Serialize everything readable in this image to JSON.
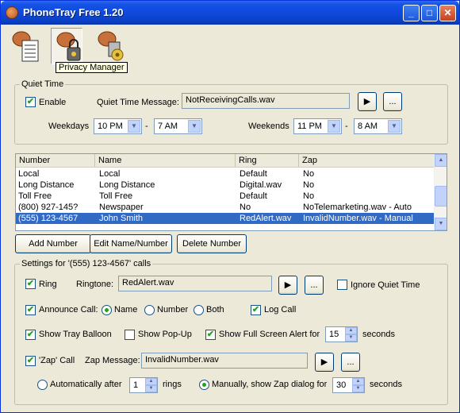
{
  "window": {
    "title": "PhoneTray Free 1.20",
    "minimize": "_",
    "maximize": "□",
    "close": "✕"
  },
  "toolbar": {
    "tooltip": "Privacy Manager"
  },
  "quiet_time": {
    "group_title": "Quiet Time",
    "enable_label": "Enable",
    "enable_checked": "✔",
    "message_label": "Quiet Time Message:",
    "message_value": "NotReceivingCalls.wav",
    "browse": "...",
    "play": "▶",
    "weekdays_label": "Weekdays",
    "weekdays_from": "10 PM",
    "weekdays_to": "7 AM",
    "weekends_label": "Weekends",
    "weekends_from": "11 PM",
    "weekends_to": "8 AM",
    "dash": "-"
  },
  "list": {
    "columns": [
      "Number",
      "Name",
      "Ring",
      "Zap"
    ],
    "rows": [
      [
        "Local",
        "Local",
        "Default",
        "No"
      ],
      [
        "Long Distance",
        "Long Distance",
        "Digital.wav",
        "No"
      ],
      [
        "Toll Free",
        "Toll Free",
        "Default",
        "No"
      ],
      [
        "(800) 927-145?",
        "Newspaper",
        "No",
        "NoTelemarketing.wav - Auto"
      ],
      [
        "(555) 123-4567",
        "John Smith",
        "RedAlert.wav",
        "InvalidNumber.wav - Manual"
      ]
    ]
  },
  "buttons": {
    "add": "Add Number",
    "edit": "Edit Name/Number",
    "delete": "Delete Number"
  },
  "settings": {
    "group_title": "Settings for '(555) 123-4567' calls",
    "ring_label": "Ring",
    "ringtone_label": "Ringtone:",
    "ringtone_value": "RedAlert.wav",
    "ignore_quiet": "Ignore Quiet Time",
    "announce_label": "Announce Call:",
    "opt_name": "Name",
    "opt_number": "Number",
    "opt_both": "Both",
    "log_call": "Log Call",
    "tray_balloon": "Show Tray Balloon",
    "popup": "Show Pop-Up",
    "fullscreen": "Show Full Screen Alert for",
    "fullscreen_secs": "15",
    "seconds": "seconds",
    "zap_label": "'Zap' Call",
    "zap_msg_label": "Zap Message:",
    "zap_msg_value": "InvalidNumber.wav",
    "auto_after": "Automatically after",
    "auto_rings": "1",
    "rings": "rings",
    "manual": "Manually, show Zap dialog for",
    "manual_secs": "30",
    "check": "✔"
  }
}
